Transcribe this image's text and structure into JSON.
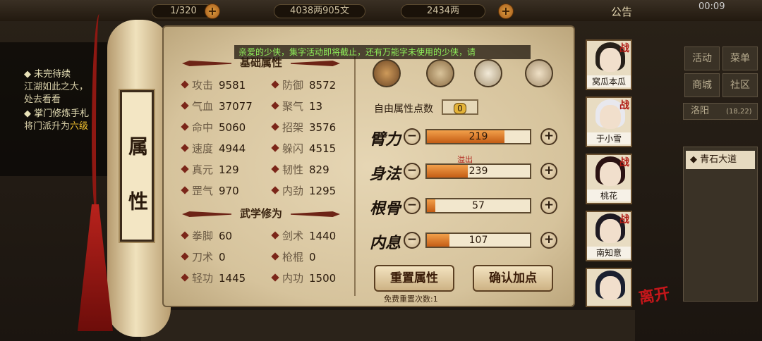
{
  "topbar": {
    "bag": "1/320",
    "money": "4038两905文",
    "gold": "2434两",
    "announce": "公告",
    "time": "00:09"
  },
  "quests": {
    "title1": "未完待续",
    "text1": "江湖如此之大，",
    "text2": "处去看看",
    "title2": "掌门修炼手札",
    "text3": "将门派升为",
    "text3_highlight": "六级"
  },
  "right_menu": {
    "activity": "活动",
    "menu": "菜单",
    "mall": "商城",
    "community": "社区",
    "location": "洛阳",
    "coords": "(18,22)",
    "path": "青石大道"
  },
  "scroll_title": "属 性",
  "notice": "亲爱的少侠，集字活动即将截止，还有万能字未使用的少侠，请",
  "basic": {
    "title": "基础属性",
    "stats": [
      {
        "label": "攻击",
        "value": "9581"
      },
      {
        "label": "防御",
        "value": "8572"
      },
      {
        "label": "气血",
        "value": "37077"
      },
      {
        "label": "聚气",
        "value": "13"
      },
      {
        "label": "命中",
        "value": "5060"
      },
      {
        "label": "招架",
        "value": "3576"
      },
      {
        "label": "速度",
        "value": "4944"
      },
      {
        "label": "躲闪",
        "value": "4515"
      },
      {
        "label": "真元",
        "value": "129"
      },
      {
        "label": "韧性",
        "value": "829"
      },
      {
        "label": "罡气",
        "value": "970"
      },
      {
        "label": "内劲",
        "value": "1295"
      }
    ]
  },
  "martial": {
    "title": "武学修为",
    "stats": [
      {
        "label": "拳脚",
        "value": "60"
      },
      {
        "label": "剑术",
        "value": "1440"
      },
      {
        "label": "刀术",
        "value": "0"
      },
      {
        "label": "枪棍",
        "value": "0"
      },
      {
        "label": "轻功",
        "value": "1445"
      },
      {
        "label": "内功",
        "value": "1500"
      }
    ]
  },
  "attributes": {
    "free_label": "自由属性点数",
    "free_points": "0",
    "overflow": "溢出",
    "items": [
      {
        "label": "臂力",
        "value": "219",
        "fill": 0.75
      },
      {
        "label": "身法",
        "value": "239",
        "fill": 0.4
      },
      {
        "label": "根骨",
        "value": "57",
        "fill": 0.08
      },
      {
        "label": "内息",
        "value": "107",
        "fill": 0.22
      }
    ]
  },
  "buttons": {
    "reset": "重置属性",
    "confirm": "确认加点",
    "free_reset": "免费重置次数:1"
  },
  "characters": [
    {
      "name": "窝瓜本瓜",
      "badge": "战"
    },
    {
      "name": "于小雪",
      "badge": "战"
    },
    {
      "name": "桃花",
      "badge": "战"
    },
    {
      "name": "南知意",
      "badge": "战"
    },
    {
      "name": "",
      "badge": ""
    }
  ],
  "leave": "离开",
  "tab_icon": "修"
}
